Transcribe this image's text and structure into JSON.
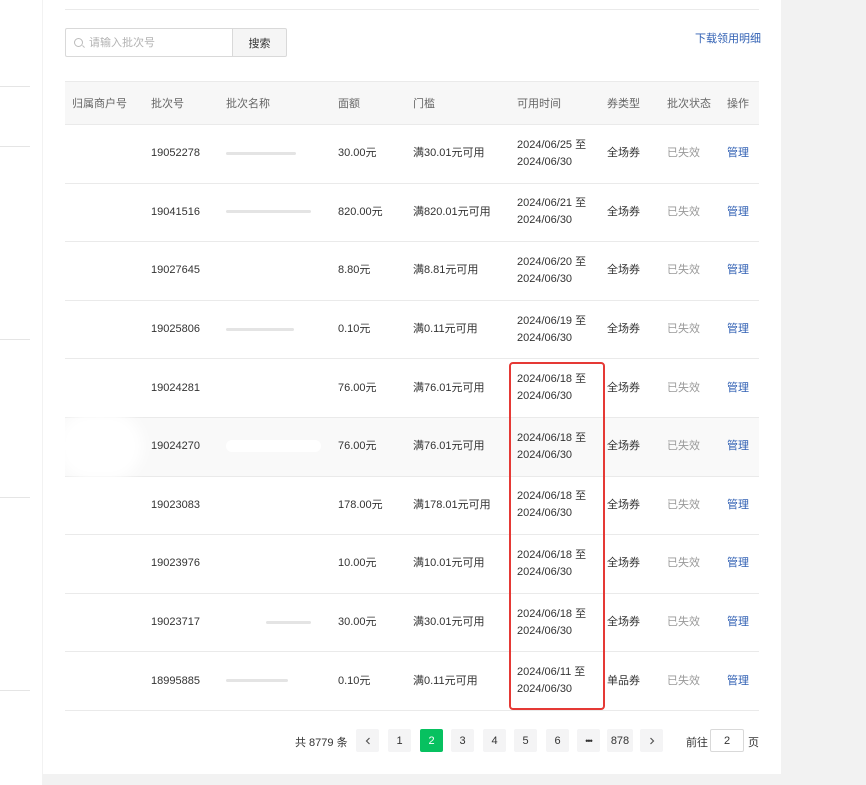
{
  "search": {
    "placeholder": "请输入批次号",
    "button": "搜索"
  },
  "download_link": "下载领用明细",
  "columns": [
    "归属商户号",
    "批次号",
    "批次名称",
    "面额",
    "门槛",
    "可用时间",
    "券类型",
    "批次状态",
    "操作"
  ],
  "rows": [
    {
      "batch_no": "19052278",
      "amount": "30.00元",
      "threshold": "满30.01元可用",
      "time_start": "2024/06/25 至",
      "time_end": "2024/06/30",
      "type": "全场券",
      "status": "已失效",
      "action": "管理"
    },
    {
      "batch_no": "19041516",
      "amount": "820.00元",
      "threshold": "满820.01元可用",
      "time_start": "2024/06/21 至",
      "time_end": "2024/06/30",
      "type": "全场券",
      "status": "已失效",
      "action": "管理"
    },
    {
      "batch_no": "19027645",
      "amount": "8.80元",
      "threshold": "满8.81元可用",
      "time_start": "2024/06/20 至",
      "time_end": "2024/06/30",
      "type": "全场券",
      "status": "已失效",
      "action": "管理"
    },
    {
      "batch_no": "19025806",
      "amount": "0.10元",
      "threshold": "满0.11元可用",
      "time_start": "2024/06/19 至",
      "time_end": "2024/06/30",
      "type": "全场券",
      "status": "已失效",
      "action": "管理"
    },
    {
      "batch_no": "19024281",
      "amount": "76.00元",
      "threshold": "满76.01元可用",
      "time_start": "2024/06/18 至",
      "time_end": "2024/06/30",
      "type": "全场券",
      "status": "已失效",
      "action": "管理"
    },
    {
      "batch_no": "19024270",
      "amount": "76.00元",
      "threshold": "满76.01元可用",
      "time_start": "2024/06/18 至",
      "time_end": "2024/06/30",
      "type": "全场券",
      "status": "已失效",
      "action": "管理"
    },
    {
      "batch_no": "19023083",
      "amount": "178.00元",
      "threshold": "满178.01元可用",
      "time_start": "2024/06/18 至",
      "time_end": "2024/06/30",
      "type": "全场券",
      "status": "已失效",
      "action": "管理"
    },
    {
      "batch_no": "19023976",
      "amount": "10.00元",
      "threshold": "满10.01元可用",
      "time_start": "2024/06/18 至",
      "time_end": "2024/06/30",
      "type": "全场券",
      "status": "已失效",
      "action": "管理"
    },
    {
      "batch_no": "19023717",
      "amount": "30.00元",
      "threshold": "满30.01元可用",
      "time_start": "2024/06/18 至",
      "time_end": "2024/06/30",
      "type": "全场券",
      "status": "已失效",
      "action": "管理"
    },
    {
      "batch_no": "18995885",
      "amount": "0.10元",
      "threshold": "满0.11元可用",
      "time_start": "2024/06/11 至",
      "time_end": "2024/06/30",
      "type": "单品券",
      "status": "已失效",
      "action": "管理"
    }
  ],
  "pagination": {
    "total_text": "共 8779 条",
    "prev_icon": "chevron-left-icon",
    "pages": [
      "1",
      "2",
      "3",
      "4",
      "5",
      "6",
      "•••",
      "878"
    ],
    "current": "2",
    "next_icon": "chevron-right-icon",
    "goto_label": "前往",
    "goto_value": "2",
    "goto_suffix": "页"
  },
  "colors": {
    "accent": "#07c160",
    "link": "#2f5fb3",
    "highlight": "#e53935"
  }
}
